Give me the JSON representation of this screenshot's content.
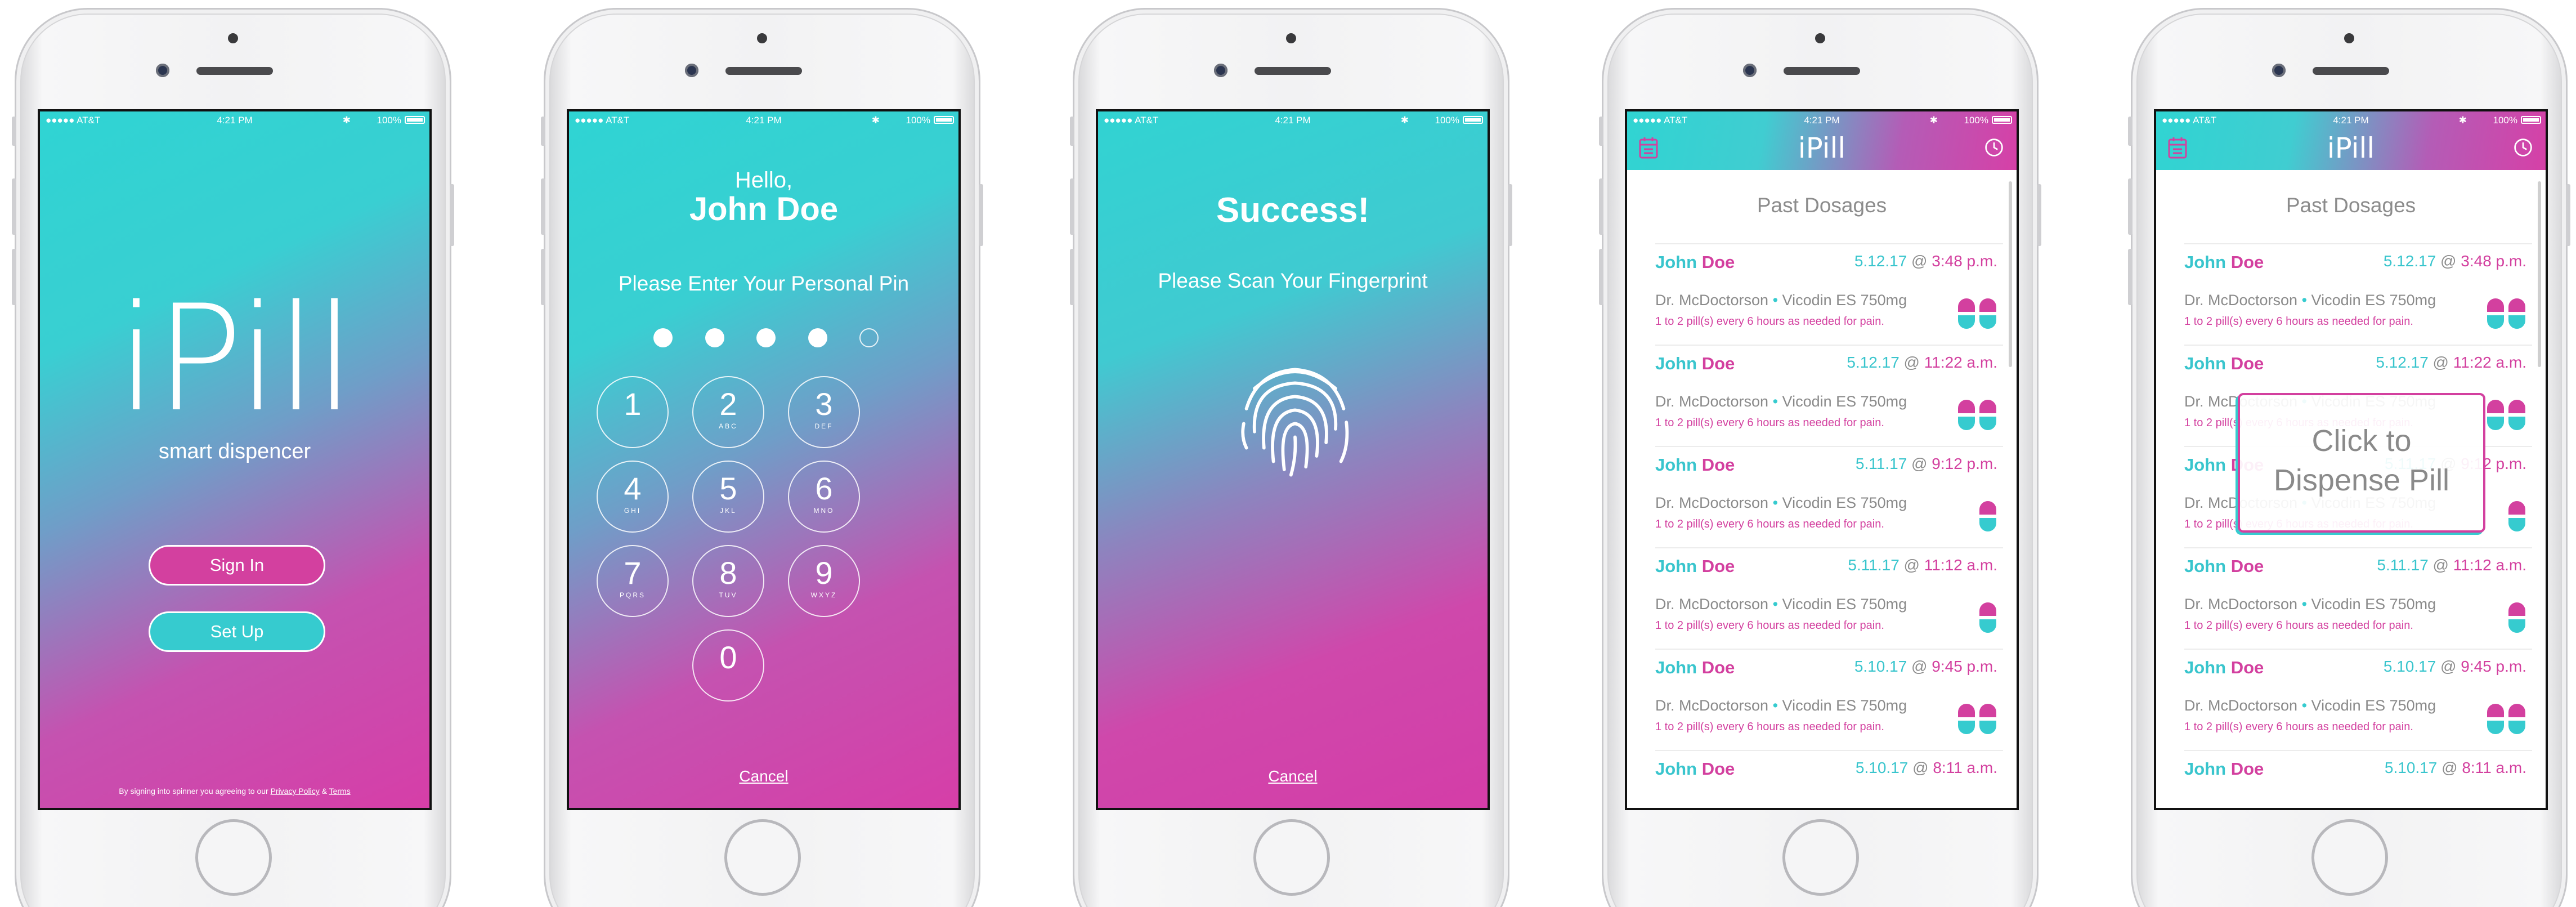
{
  "status_bar": {
    "carrier": "●●●●● AT&T",
    "time": "4:21 PM",
    "battery": "100%",
    "bluetooth": "✱"
  },
  "screen1": {
    "logo": "iPill",
    "tagline": "smart dispencer",
    "signin_label": "Sign In",
    "setup_label": "Set Up",
    "terms_prefix": "By signing into spinner you agreeing to our ",
    "privacy_label": "Privacy Policy",
    "terms_amp": " & ",
    "terms_label": "Terms"
  },
  "screen2": {
    "hello": "Hello,",
    "name": "John Doe",
    "prompt": "Please Enter Your Personal Pin",
    "pin_filled": 4,
    "pin_total": 5,
    "keys": [
      {
        "num": "1",
        "sub": ""
      },
      {
        "num": "2",
        "sub": "ABC"
      },
      {
        "num": "3",
        "sub": "DEF"
      },
      {
        "num": "4",
        "sub": "GHI"
      },
      {
        "num": "5",
        "sub": "JKL"
      },
      {
        "num": "6",
        "sub": "MNO"
      },
      {
        "num": "7",
        "sub": "PQRS"
      },
      {
        "num": "8",
        "sub": "TUV"
      },
      {
        "num": "9",
        "sub": "WXYZ"
      },
      {
        "num": "0",
        "sub": ""
      }
    ],
    "cancel_label": "Cancel"
  },
  "screen3": {
    "title": "Success!",
    "prompt": "Please Scan Your Fingerprint",
    "icon": "fingerprint-icon",
    "cancel_label": "Cancel"
  },
  "app": {
    "title": "iPill",
    "left_icon": "calendar-icon",
    "right_icon": "clock-icon",
    "list_title": "Past Dosages",
    "first": "John",
    "last": "Doe",
    "at": "@",
    "doctor": "Dr. McDoctorson",
    "bullet": "•",
    "medication": "Vicodin ES 750mg",
    "instructions": "1 to 2 pill(s) every 6 hours as needed for pain.",
    "rows": [
      {
        "date": "5.12.17",
        "time": "3:48 p.m.",
        "pills": 2
      },
      {
        "date": "5.12.17",
        "time": "11:22 a.m.",
        "pills": 2
      },
      {
        "date": "5.11.17",
        "time": "9:12 p.m.",
        "pills": 1
      },
      {
        "date": "5.11.17",
        "time": "11:12 a.m.",
        "pills": 1
      },
      {
        "date": "5.10.17",
        "time": "9:45 p.m.",
        "pills": 2
      },
      {
        "date": "5.10.17",
        "time": "8:11 a.m.",
        "pills": 0
      }
    ]
  },
  "screen5": {
    "tooltip_line1": "Click to",
    "tooltip_line2": "Dispense Pill"
  },
  "colors": {
    "teal": "#36cbcf",
    "pink": "#d3409f",
    "gray_text": "#8a8a8a"
  }
}
